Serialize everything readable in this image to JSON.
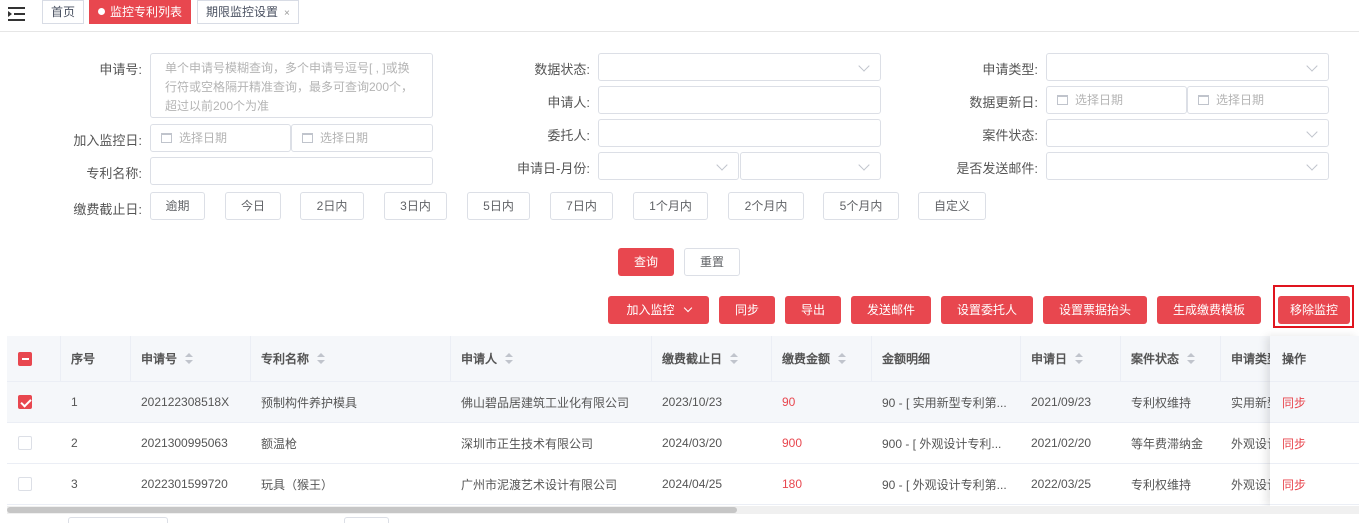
{
  "tabs": [
    {
      "label": "首页"
    },
    {
      "label": "监控专利列表"
    },
    {
      "label": "期限监控设置",
      "close": "×"
    }
  ],
  "form": {
    "app_no_label": "申请号:",
    "app_no_placeholder": "单个申请号模糊查询，多个申请号逗号[ , ]或换行符或空格隔开精准查询，最多可查询200个，超过以前200个为准",
    "add_date_label": "加入监控日:",
    "date_placeholder": "选择日期",
    "patent_name_label": "专利名称:",
    "fee_deadline_label": "缴费截止日:",
    "data_status_label": "数据状态:",
    "applicant_label": "申请人:",
    "client_label": "委托人:",
    "app_month_label": "申请日-月份:",
    "app_type_label": "申请类型:",
    "data_update_label": "数据更新日:",
    "case_status_label": "案件状态:",
    "send_mail_label": "是否发送邮件:",
    "quick_ranges": [
      "逾期",
      "今日",
      "2日内",
      "3日内",
      "5日内",
      "7日内",
      "1个月内",
      "2个月内",
      "5个月内",
      "自定义"
    ]
  },
  "actions": {
    "query": "查询",
    "reset": "重置",
    "add_monitor": "加入监控",
    "sync": "同步",
    "export": "导出",
    "send_mail": "发送邮件",
    "set_client": "设置委托人",
    "set_invoice": "设置票据抬头",
    "gen_template": "生成缴费模板",
    "remove_monitor": "移除监控"
  },
  "table": {
    "headers": {
      "index": "序号",
      "app_no": "申请号",
      "patent_name": "专利名称",
      "applicant": "申请人",
      "deadline": "缴费截止日",
      "amount": "缴费金额",
      "detail": "金额明细",
      "app_date": "申请日",
      "case_status": "案件状态",
      "app_type": "申请类型",
      "op": "操作"
    },
    "rows": [
      {
        "checked": true,
        "index": "1",
        "app_no": "202122308518X",
        "patent_name": "预制构件养护模具",
        "applicant": "佛山碧品居建筑工业化有限公司",
        "deadline": "2023/10/23",
        "amount": "90",
        "detail": "90 - [ 实用新型专利第...",
        "app_date": "2021/09/23",
        "case_status": "专利权维持",
        "app_type": "实用新型",
        "op": "同步"
      },
      {
        "checked": false,
        "index": "2",
        "app_no": "2021300995063",
        "patent_name": "额温枪",
        "applicant": "深圳市正生技术有限公司",
        "deadline": "2024/03/20",
        "amount": "900",
        "detail": "900 - [ 外观设计专利...",
        "app_date": "2021/02/20",
        "case_status": "等年费滞纳金",
        "app_type": "外观设计",
        "op": "同步"
      },
      {
        "checked": false,
        "index": "3",
        "app_no": "2022301599720",
        "patent_name": "玩具（猴王）",
        "applicant": "广州市泥渡艺术设计有限公司",
        "deadline": "2024/04/25",
        "amount": "180",
        "detail": "90 - [ 外观设计专利第...",
        "app_date": "2022/03/25",
        "case_status": "专利权维持",
        "app_type": "外观设计",
        "op": "同步"
      }
    ]
  },
  "colors": {
    "accent": "#e8474f",
    "highlight": "#e0141e"
  }
}
